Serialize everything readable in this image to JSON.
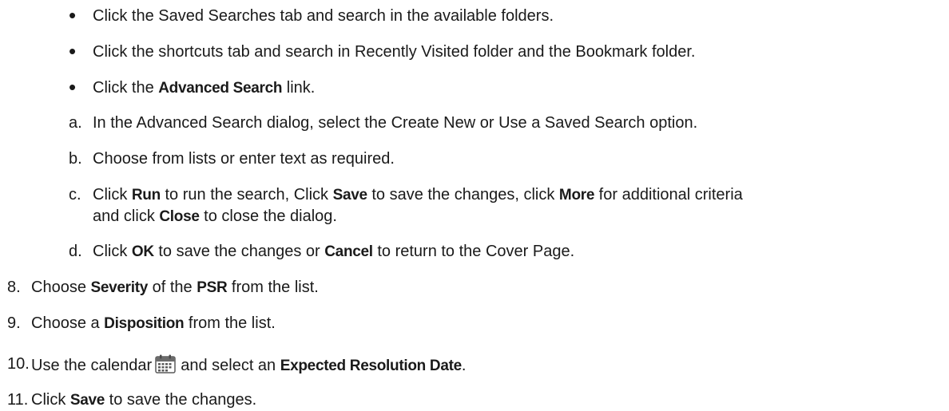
{
  "bullets": [
    {
      "marker": "•",
      "parts": [
        {
          "t": "Click the Saved Searches tab and search in the available folders."
        }
      ]
    },
    {
      "marker": "•",
      "parts": [
        {
          "t": "Click the shortcuts tab and search in Recently Visited folder and the Bookmark folder."
        }
      ]
    },
    {
      "marker": "•",
      "parts": [
        {
          "t": "Click the "
        },
        {
          "t": "Advanced Search",
          "b": true
        },
        {
          "t": " link."
        }
      ]
    }
  ],
  "substeps": [
    {
      "marker": "a.",
      "lines": [
        [
          {
            "t": "In the Advanced Search dialog, select the Create New or Use a Saved Search option."
          }
        ]
      ]
    },
    {
      "marker": "b.",
      "lines": [
        [
          {
            "t": "Choose from lists or enter text as required."
          }
        ]
      ]
    },
    {
      "marker": "c.",
      "lines": [
        [
          {
            "t": "Click "
          },
          {
            "t": "Run",
            "b": true
          },
          {
            "t": " to run the search, Click "
          },
          {
            "t": "Save",
            "b": true
          },
          {
            "t": " to save the changes, click "
          },
          {
            "t": "More",
            "b": true
          },
          {
            "t": " for additional criteria"
          }
        ],
        [
          {
            "t": "and click "
          },
          {
            "t": "Close",
            "b": true
          },
          {
            "t": " to close the dialog."
          }
        ]
      ]
    },
    {
      "marker": "d.",
      "lines": [
        [
          {
            "t": "Click "
          },
          {
            "t": "OK",
            "b": true
          },
          {
            "t": " to save the changes or "
          },
          {
            "t": "Cancel",
            "b": true
          },
          {
            "t": " to return to the Cover Page."
          }
        ]
      ]
    }
  ],
  "steps": [
    {
      "marker": "8.",
      "parts": [
        {
          "t": "Choose "
        },
        {
          "t": "Severity",
          "b": true
        },
        {
          "t": " of the "
        },
        {
          "t": "PSR",
          "b": true
        },
        {
          "t": " from the list."
        }
      ]
    },
    {
      "marker": "9.",
      "parts": [
        {
          "t": "Choose a "
        },
        {
          "t": "Disposition",
          "b": true
        },
        {
          "t": " from the list."
        }
      ]
    },
    {
      "marker": "10.",
      "parts": [
        {
          "t": "Use the calendar"
        },
        {
          "icon": "calendar-icon"
        },
        {
          "t": "and select an "
        },
        {
          "t": "Expected Resolution Date",
          "b": true
        },
        {
          "t": "."
        }
      ]
    },
    {
      "marker": "11.",
      "parts": [
        {
          "t": "Click "
        },
        {
          "t": "Save",
          "b": true
        },
        {
          "t": " to save the changes."
        }
      ]
    }
  ],
  "colors": {
    "text": "#1a1a1a",
    "icon_frame": "#5a5a5a",
    "icon_header": "#6b6b6b"
  }
}
